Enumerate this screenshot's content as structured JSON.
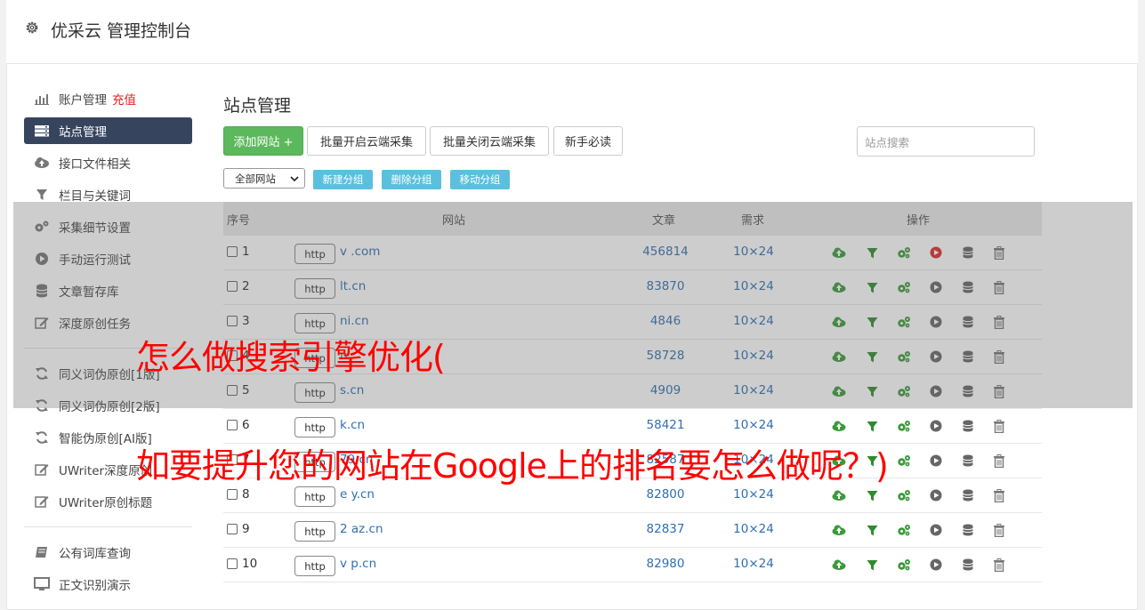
{
  "header": {
    "title": "优采云 管理控制台"
  },
  "sidebar": {
    "items": [
      {
        "label": "账户管理",
        "extra": "充值",
        "icon": "bar-chart-icon"
      },
      {
        "label": "站点管理",
        "icon": "server-icon",
        "active": true
      },
      {
        "label": "接口文件相关",
        "icon": "cloud-upload-icon"
      },
      {
        "label": "栏目与关键词",
        "icon": "filter-icon"
      },
      {
        "label": "采集细节设置",
        "icon": "cogs-icon"
      },
      {
        "label": "手动运行测试",
        "icon": "play-circle-icon"
      },
      {
        "label": "文章暂存库",
        "icon": "database-icon"
      },
      {
        "label": "深度原创任务",
        "icon": "edit-icon"
      },
      {
        "label": "同义词伪原创[1版]",
        "icon": "refresh-icon"
      },
      {
        "label": "同义词伪原创[2版]",
        "icon": "refresh-icon"
      },
      {
        "label": "智能伪原创[AI版]",
        "icon": "refresh-icon"
      },
      {
        "label": "UWriter深度原创",
        "icon": "edit-icon"
      },
      {
        "label": "UWriter原创标题",
        "icon": "edit-icon"
      },
      {
        "label": "公有词库查询",
        "icon": "book-icon"
      },
      {
        "label": "正文识别演示",
        "icon": "monitor-icon"
      }
    ]
  },
  "main": {
    "title": "站点管理",
    "toolbar": {
      "add_site": "添加网站 +",
      "batch_open": "批量开启云端采集",
      "batch_close": "批量关闭云端采集",
      "guide": "新手必读",
      "search_placeholder": "站点搜索"
    },
    "group_select": "全部网站",
    "group_buttons": {
      "new": "新建分组",
      "delete": "删除分组",
      "move": "移动分组"
    },
    "table": {
      "headers": {
        "index": "序号",
        "site": "网站",
        "articles": "文章",
        "demand": "需求",
        "ops": "操作"
      },
      "rows": [
        {
          "index": "1",
          "proto": "http",
          "site": "v              .com",
          "articles": "456814",
          "demand": "10×24",
          "play_active": true
        },
        {
          "index": "2",
          "proto": "http",
          "site": "      lt.cn",
          "articles": "83870",
          "demand": "10×24"
        },
        {
          "index": "3",
          "proto": "http",
          "site": "      ni.cn",
          "articles": "4846",
          "demand": "10×24"
        },
        {
          "index": "4",
          "proto": "http",
          "site": "        n",
          "articles": "58728",
          "demand": "10×24"
        },
        {
          "index": "5",
          "proto": "http",
          "site": "        s.cn",
          "articles": "4909",
          "demand": "10×24"
        },
        {
          "index": "6",
          "proto": "http",
          "site": "      k.cn",
          "articles": "58421",
          "demand": "10×24"
        },
        {
          "index": "7",
          "proto": "http",
          "site": "     79.cn",
          "articles": "82587",
          "demand": "10×24"
        },
        {
          "index": "8",
          "proto": "http",
          "site": "e      y.cn",
          "articles": "82800",
          "demand": "10×24"
        },
        {
          "index": "9",
          "proto": "http",
          "site": "2      az.cn",
          "articles": "82837",
          "demand": "10×24"
        },
        {
          "index": "10",
          "proto": "http",
          "site": "v      p.cn",
          "articles": "82980",
          "demand": "10×24"
        }
      ]
    }
  },
  "overlay": {
    "line1": "怎么做搜索引擎优化(",
    "line2": "如要提升您的网站在Google上的排名要怎么做呢？)"
  },
  "colors": {
    "accent": "#36445e",
    "green": "#5cb85c",
    "link": "#2f6fb0",
    "info": "#5bc0de",
    "red": "#ff0000"
  }
}
